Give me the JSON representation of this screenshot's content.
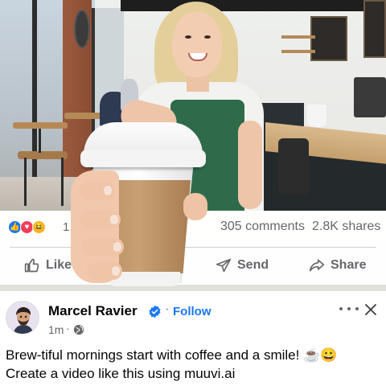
{
  "post": {
    "reactions": {
      "icons": [
        "like-icon",
        "love-icon",
        "haha-icon"
      ],
      "count": "1.2",
      "comments": "305 comments",
      "shares": "2.8K shares"
    },
    "actions": {
      "like": "Like",
      "comment_partial": "t",
      "send": "Send",
      "share": "Share"
    },
    "author": {
      "name": "Marcel Ravier",
      "follow": "Follow",
      "dot_separator": "·",
      "time": "1m",
      "visibility_icon": "globe-icon"
    },
    "caption_line1": "Brew-tiful mornings start with coffee and a smile! ☕😀",
    "caption_line2": "Create a video like this using muuvi.ai"
  },
  "colors": {
    "accent_blue": "#1877f2",
    "secondary_text": "#65676b",
    "like_blue": "#1877f2",
    "love_red": "#f33e58",
    "haha_yellow": "#f7b125"
  }
}
